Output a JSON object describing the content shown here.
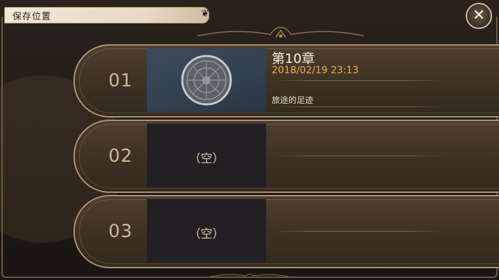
{
  "header": {
    "title": "保存位置",
    "close_icon": "close-icon"
  },
  "slots": [
    {
      "number": "01",
      "filled": true,
      "chapter": "第10章",
      "datetime": "2018/02/19 23:13",
      "description": "旅途的足迹",
      "thumbnail_icon": "ornate-medallion-icon"
    },
    {
      "number": "02",
      "filled": false,
      "empty_label": "（空）"
    },
    {
      "number": "03",
      "filled": false,
      "empty_label": "（空）"
    }
  ],
  "colors": {
    "accent_gold": "#e7b24a",
    "slot_border": "#a99478",
    "title_tab": "#f1e8d6"
  }
}
